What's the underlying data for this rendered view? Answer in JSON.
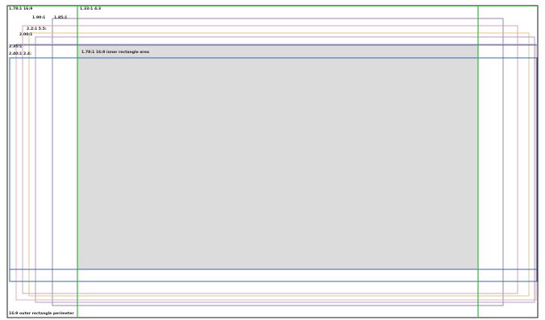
{
  "labels": {
    "ratio_1_78": "1.78:1 16:9",
    "ratio_1_33": "1.33:1 4:3",
    "ratio_1_90": "1.90:1",
    "ratio_1_85": "1.85:1",
    "ratio_2_2": "2.2:1 5.5:",
    "ratio_2_00": "2.00:1",
    "ratio_2_35": "2.35:1",
    "ratio_2_40": "2.40:1 2.4:",
    "inner_area": "1.78:1 16:9 inner rectangle area",
    "outer_perimeter": "16:9 outer rectangle perimeter"
  },
  "colors": {
    "frame": "#1a1a1a",
    "green": "#3fae3f",
    "blue": "#3a6aa8",
    "pink": "#d6a3b4",
    "yellow": "#d8c98a",
    "purple": "#9a86b0",
    "inner_fill": "#dcdcdc"
  }
}
